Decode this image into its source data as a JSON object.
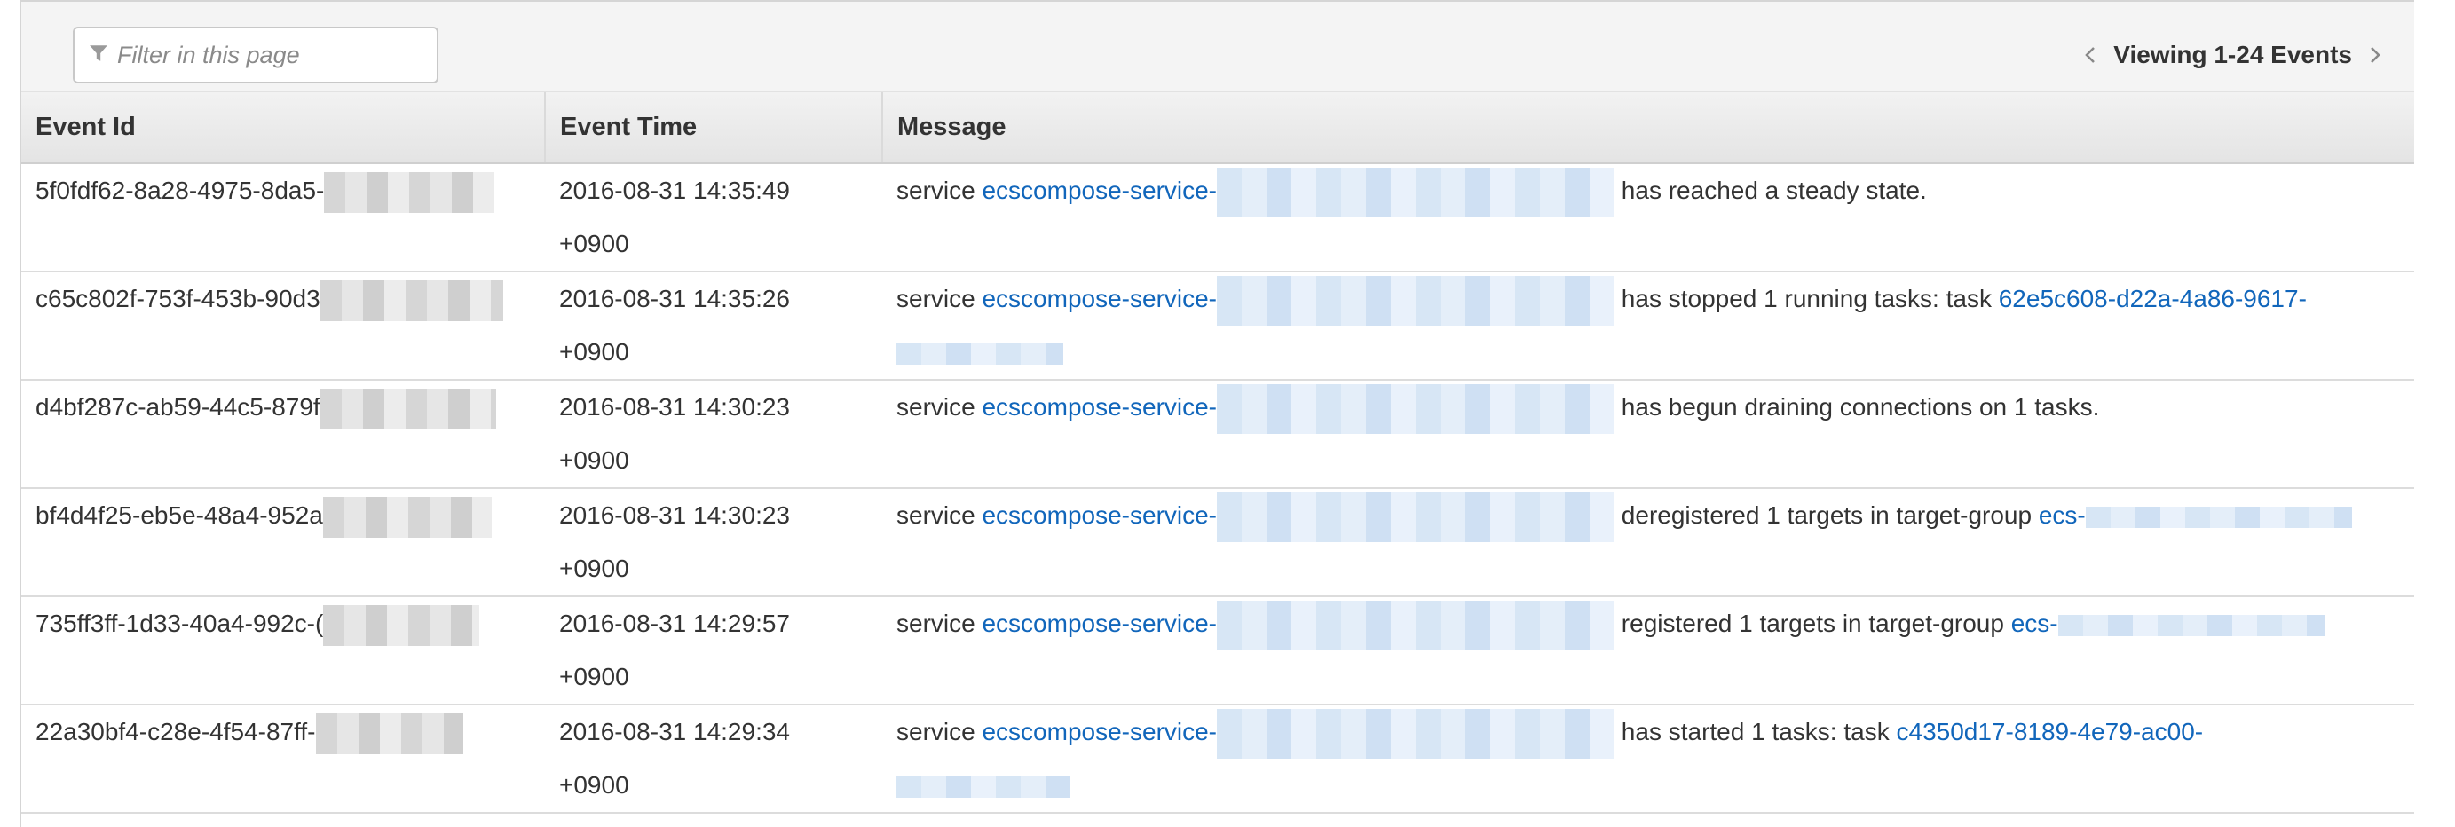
{
  "toolbar": {
    "filter_placeholder": "Filter in this page",
    "pager_label": "Viewing 1-24 Events"
  },
  "table": {
    "headers": [
      "Event Id",
      "Event Time",
      "Message"
    ]
  },
  "rows": [
    {
      "id": "5f0fdf62-8a28-4975-8da5-",
      "time": "2016-08-31 14:35:49",
      "tz": "+0900",
      "msg_prefix": "service",
      "service_link": "ecscompose-service-",
      "msg_text": "has reached a steady state.",
      "trailing_link": ""
    },
    {
      "id": "c65c802f-753f-453b-90d3",
      "time": "2016-08-31 14:35:26",
      "tz": "+0900",
      "msg_prefix": "service",
      "service_link": "ecscompose-service-",
      "msg_text": "has stopped 1 running tasks: task",
      "trailing_link": "62e5c608-d22a-4a86-9617-"
    },
    {
      "id": "d4bf287c-ab59-44c5-879f",
      "time": "2016-08-31 14:30:23",
      "tz": "+0900",
      "msg_prefix": "service",
      "service_link": "ecscompose-service-",
      "msg_text": "has begun draining connections on 1 tasks.",
      "trailing_link": ""
    },
    {
      "id": "bf4d4f25-eb5e-48a4-952a",
      "time": "2016-08-31 14:30:23",
      "tz": "+0900",
      "msg_prefix": "service",
      "service_link": "ecscompose-service-",
      "msg_text": "deregistered 1 targets in target-group",
      "trailing_link": "ecs-"
    },
    {
      "id": "735ff3ff-1d33-40a4-992c-(",
      "time": "2016-08-31 14:29:57",
      "tz": "+0900",
      "msg_prefix": "service",
      "service_link": "ecscompose-service-",
      "msg_text": "registered 1 targets in target-group",
      "trailing_link": "ecs-"
    },
    {
      "id": "22a30bf4-c28e-4f54-87ff-",
      "time": "2016-08-31 14:29:34",
      "tz": "+0900",
      "msg_prefix": "service",
      "service_link": "ecscompose-service-",
      "msg_text": "has started 1 tasks: task",
      "trailing_link": "c4350d17-8189-4e79-ac00-"
    }
  ],
  "icons": {
    "filter": "filter-icon",
    "prev": "chevron-left-icon",
    "next": "chevron-right-icon"
  },
  "colors": {
    "link": "#1166bb",
    "header_bg": "#e8e8e8"
  }
}
